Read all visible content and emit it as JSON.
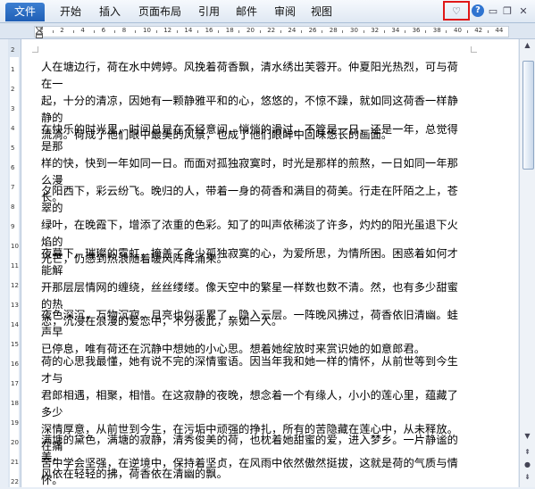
{
  "ribbon": {
    "file_label": "文件",
    "tabs": [
      "开始",
      "插入",
      "页面布局",
      "引用",
      "邮件",
      "审阅",
      "视图"
    ]
  },
  "ruler": {
    "marks": [
      "2",
      "2",
      "4",
      "6",
      "8",
      "10",
      "12",
      "14",
      "16",
      "18",
      "20",
      "22",
      "24",
      "26",
      "28",
      "30",
      "32",
      "34",
      "36",
      "38",
      "40",
      "42",
      "44"
    ],
    "vnums": [
      "2",
      "1",
      "2",
      "3",
      "4",
      "5",
      "6",
      "7",
      "8",
      "9",
      "10",
      "11",
      "12",
      "13",
      "14",
      "15",
      "16",
      "17",
      "18",
      "19",
      "20",
      "21",
      "22"
    ]
  },
  "document": {
    "paragraphs": [
      [
        "人在塘边行，荷在水中娉婷。风挽着荷香飘，清水绣出芙蓉开。仲夏阳光热烈，可与荷在一",
        "起，十分的清凉，因她有一颗静雅平和的心，悠悠的，不惊不躁，就如同这荷香一样静静的",
        "流淌。荷成了他们眼中最美的风景，也成了他们眼眸中回味悠长的画面。"
      ],
      [
        "在快乐的时光里，时间总是在不经意间，悄悄的滑过。不管是一日，还是一年，总觉得是那",
        "样的快，快到一年如同一日。而面对孤独寂寞时，时光是那样的煎熬，一日如同一年那么漫",
        "长。"
      ],
      [
        "夕阳西下，彩云纷飞。晚归的人，带着一身的荷香和满目的荷美。行走在阡陌之上，苍翠的",
        "绿叶，在晚霞下，增添了浓重的色彩。知了的叫声依稀淡了许多，灼灼的阳光虽退下火焰的",
        "光芒，仍感到热浪随着暖风阵阵涌来。"
      ],
      [
        "夜幕下，璀璨的霓虹，掩盖了多少孤独寂寞的心，为爱所思，为情所困。困惑着如何才能解",
        "开那层层情网的缠绕，丝丝缕缕。像天空中的繁星一样数也数不清。然，也有多少甜蜜的热",
        "恋，沉浸在浪漫的爱恋中，不分彼此，亲如一人。"
      ],
      [
        "夜色深沉，万物沉寂。月亮也似乎累了，隐入云层。一阵晚风拂过，荷香依旧清幽。蛙声早",
        "已停息，唯有荷还在沉静中想她的小心思。想着她绽放时来赏识她的如意郎君。"
      ],
      [
        "荷的心思我最懂，她有说不完的深情蜜语。因当年我和她一样的情怀，从前世等到今生才与",
        "君郎相遇，相聚，相惜。在这寂静的夜晚，想念着一个有缘人，小小的莲心里，蕴藏了多少",
        "深情厚意，从前世到今生，在污垢中顽强的挣扎，所有的苦隐藏在莲心中，从未释放。在痛",
        "苦中学会坚强，在逆境中，保持着坚贞，在风雨中依然傲然挺拔，这就是荷的气质与情怀。"
      ],
      [
        "满塘的黛色，满塘的寂静，清秀俊美的荷，也枕着她甜蜜的爱，进入梦乡。一片静谧的美，",
        "风依在轻轻的拂，荷香依在清幽的飘。"
      ]
    ]
  }
}
